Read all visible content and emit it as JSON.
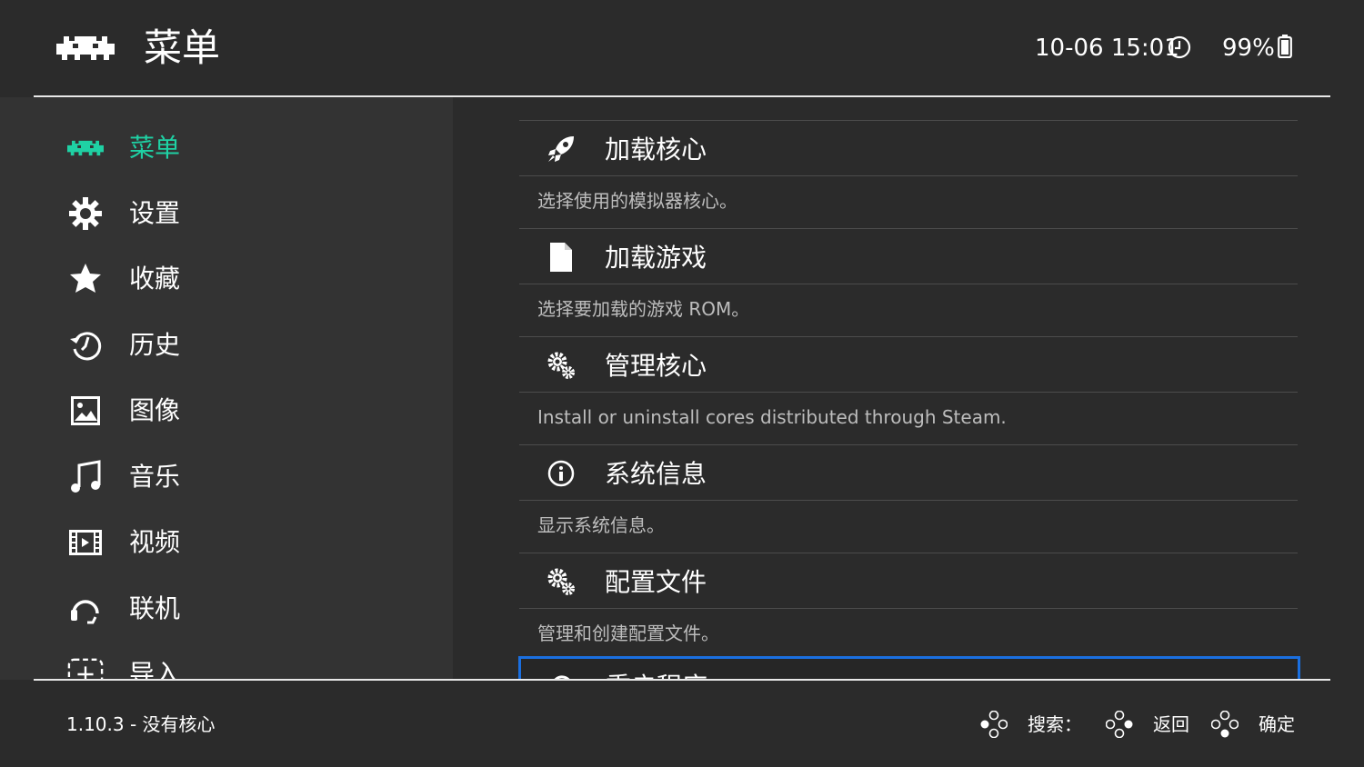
{
  "header": {
    "title": "菜单",
    "clock": "10-06 15:01",
    "battery": "99%"
  },
  "sidebar": {
    "items": [
      {
        "label": "菜单",
        "icon": "retroarch-invader-icon",
        "active": true
      },
      {
        "label": "设置",
        "icon": "gear-icon"
      },
      {
        "label": "收藏",
        "icon": "star-icon"
      },
      {
        "label": "历史",
        "icon": "history-icon"
      },
      {
        "label": "图像",
        "icon": "image-icon"
      },
      {
        "label": "音乐",
        "icon": "music-note-icon"
      },
      {
        "label": "视频",
        "icon": "video-film-icon"
      },
      {
        "label": "联机",
        "icon": "netplay-headset-icon"
      },
      {
        "label": "导入",
        "icon": "add-box-icon"
      }
    ],
    "accent": "#1fd1a4"
  },
  "main": {
    "entries": [
      {
        "label": "加载核心",
        "desc": "选择使用的模拟器核心。",
        "icon": "rocket-icon"
      },
      {
        "label": "加载游戏",
        "desc": "选择要加载的游戏 ROM。",
        "icon": "file-icon"
      },
      {
        "label": "管理核心",
        "desc": "Install or uninstall cores distributed through Steam.",
        "icon": "gears-icon"
      },
      {
        "label": "系统信息",
        "desc": "显示系统信息。",
        "icon": "info-icon"
      },
      {
        "label": "配置文件",
        "desc": "管理和创建配置文件。",
        "icon": "gears-icon"
      },
      {
        "label": "重启程序",
        "icon": "restart-icon",
        "selected": true
      }
    ],
    "selection_color": "#1a6fe0"
  },
  "footer": {
    "version": "1.10.3 - 没有核心",
    "search": "搜索：",
    "back": "返回",
    "ok": "确定"
  }
}
